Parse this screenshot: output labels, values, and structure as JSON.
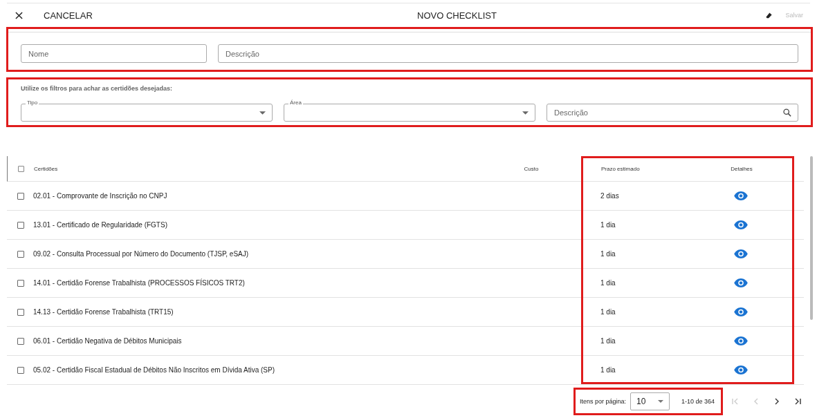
{
  "header": {
    "close_label": "CANCELAR",
    "title": "NOVO CHECKLIST",
    "save_label": "Salvar",
    "save_disabled": true
  },
  "form": {
    "name": {
      "placeholder": "Nome"
    },
    "description": {
      "placeholder": "Descrição"
    }
  },
  "filters": {
    "hint": "Utilize os filtros para achar as certidões desejadas:",
    "type": {
      "label": "Tipo"
    },
    "area": {
      "label": "Área"
    },
    "search": {
      "placeholder": "Descrição"
    }
  },
  "table": {
    "all_checked": false,
    "columns": [
      "Certidões",
      "Custo",
      "Prazo estimado",
      "Detalhes"
    ],
    "rows": [
      {
        "name": "02.01 - Comprovante de Inscrição no CNPJ",
        "deadline": "2 dias",
        "checked": false
      },
      {
        "name": "13.01 - Certificado de Regularidade (FGTS)",
        "deadline": "1 dia",
        "checked": false
      },
      {
        "name": "09.02 - Consulta Processual por Número do Documento (TJSP, eSAJ)",
        "deadline": "1 dia",
        "checked": false
      },
      {
        "name": "14.01 - Certidão Forense Trabalhista (PROCESSOS FÍSICOS TRT2)",
        "deadline": "1 dia",
        "checked": false
      },
      {
        "name": "14.13 - Certidão Forense Trabalhista (TRT15)",
        "deadline": "1 dia",
        "checked": false
      },
      {
        "name": "06.01 - Certidão Negativa de Débitos Municipais",
        "deadline": "1 dia",
        "checked": false
      },
      {
        "name": "05.02 - Certidão Fiscal Estadual de Débitos Não Inscritos em Dívida Ativa (SP)",
        "deadline": "1 dia",
        "checked": false
      }
    ]
  },
  "pagination": {
    "label": "Itens por página:",
    "page_size": "10",
    "range": "1-10 de 364",
    "buttons": [
      {
        "kind": "first",
        "disabled": true
      },
      {
        "kind": "prev",
        "disabled": true
      },
      {
        "kind": "next",
        "disabled": false
      },
      {
        "kind": "last",
        "disabled": false
      }
    ]
  }
}
